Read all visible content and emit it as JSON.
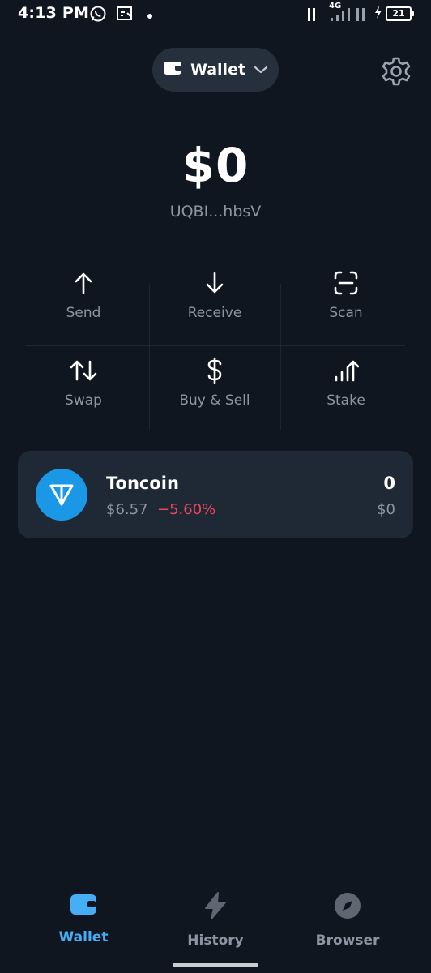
{
  "status_bar": {
    "time": "4:13 PM",
    "network_label": "4G",
    "battery_level": "21",
    "icons": [
      "whatsapp-icon",
      "screen-cast-icon",
      "notification-dot-icon",
      "signal-icon",
      "charging-icon",
      "battery-icon"
    ]
  },
  "header": {
    "wallet_label": "Wallet",
    "wallet_icon": "wallet-icon",
    "dropdown_icon": "chevron-down-icon",
    "settings_icon": "gear-icon"
  },
  "balance": {
    "amount": "$0",
    "address": "UQBI...hbsV"
  },
  "actions": [
    {
      "label": "Send",
      "icon": "arrow-up-icon"
    },
    {
      "label": "Receive",
      "icon": "arrow-down-icon"
    },
    {
      "label": "Scan",
      "icon": "scan-icon"
    },
    {
      "label": "Swap",
      "icon": "swap-icon"
    },
    {
      "label": "Buy & Sell",
      "icon": "dollar-icon"
    },
    {
      "label": "Stake",
      "icon": "stake-icon"
    }
  ],
  "tokens": [
    {
      "name": "Toncoin",
      "price": "$6.57",
      "change": "−5.60%",
      "amount": "0",
      "value": "$0",
      "icon": "toncoin-icon"
    }
  ],
  "bottom_nav": [
    {
      "label": "Wallet",
      "icon": "wallet-icon",
      "active": true
    },
    {
      "label": "History",
      "icon": "lightning-icon",
      "active": false
    },
    {
      "label": "Browser",
      "icon": "compass-icon",
      "active": false
    }
  ],
  "colors": {
    "background": "#10161f",
    "card": "#1f2835",
    "accent": "#45aef5",
    "negative": "#f0465c",
    "muted_text": "#8d95a3",
    "toncoin": "#1a98e6"
  }
}
